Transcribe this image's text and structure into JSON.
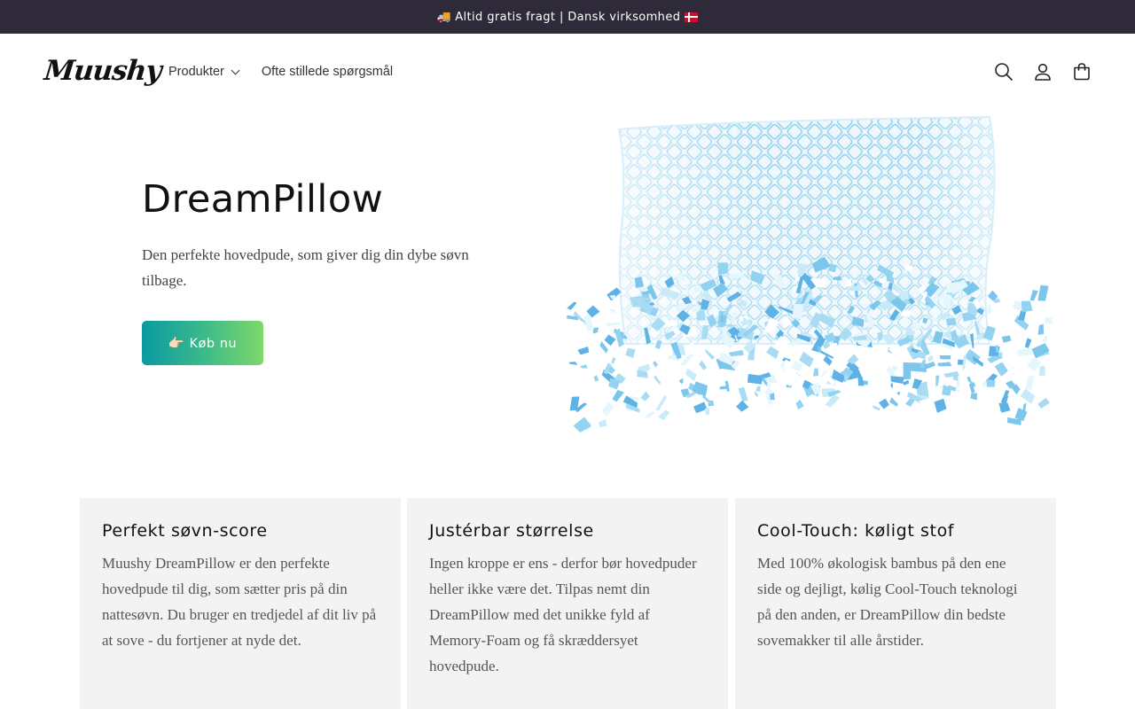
{
  "announcement": {
    "truck_icon": "🚚",
    "text": "Altid gratis fragt | Dansk virksomhed",
    "flag_icon": "danish-flag"
  },
  "header": {
    "logo": "Muushy",
    "nav": [
      {
        "label": "Produkter",
        "has_dropdown": true
      },
      {
        "label": "Ofte stillede spørgsmål",
        "has_dropdown": false
      }
    ],
    "icons": [
      "search-icon",
      "account-icon",
      "cart-icon"
    ]
  },
  "hero": {
    "title": "DreamPillow",
    "description": "Den perfekte hovedpude, som giver dig din dybe søvn tilbage.",
    "button_label": "👉🏻 Køb nu",
    "button_colors": [
      "#0a9aa2",
      "#7fd86a"
    ]
  },
  "features": [
    {
      "title": "Perfekt søvn-score",
      "text": "Muushy DreamPillow er den perfekte hovedpude til dig, som sætter pris på din nattesøvn. Du bruger en tredjedel af dit liv på at sove - du fortjener at nyde det."
    },
    {
      "title": "Justérbar størrelse",
      "text": "Ingen kroppe er ens - derfor bør hovedpuder heller ikke være det. Tilpas nemt din DreamPillow med det unikke fyld af Memory-Foam og få skræddersyet hovedpude."
    },
    {
      "title": "Cool-Touch: køligt stof",
      "text": "Med 100% økologisk bambus på den ene side og dejligt, kølig Cool-Touch teknologi på den anden, er DreamPillow din bedste sovemakker til alle årstider."
    }
  ],
  "colors": {
    "announcement_bg": "#2e2a39",
    "feature_bg": "#f3f3f3",
    "pillow_blue": "#8fd0ee"
  }
}
